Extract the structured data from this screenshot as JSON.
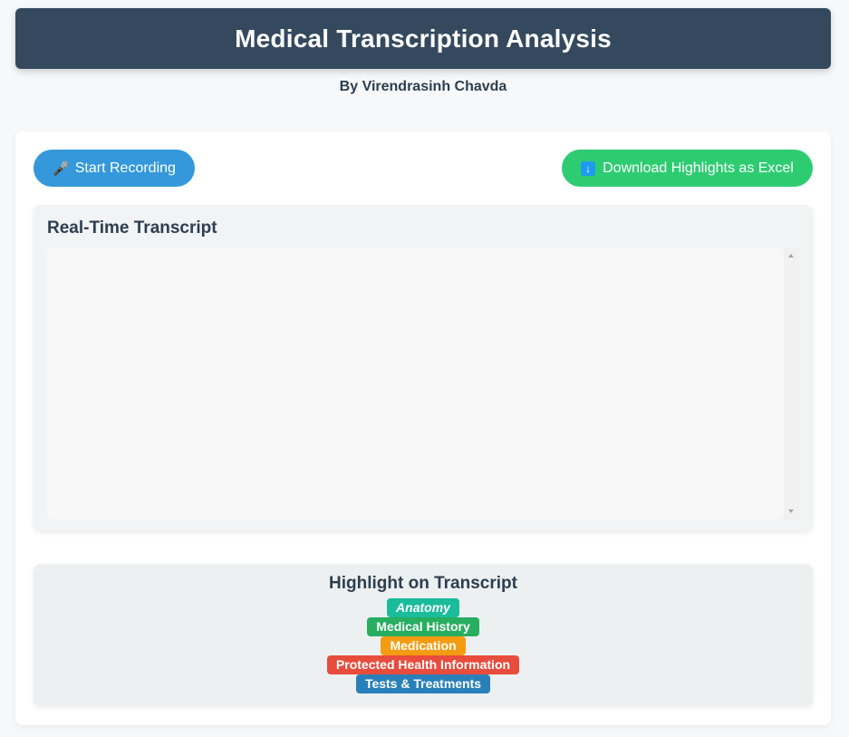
{
  "app": {
    "title": "Medical Transcription Analysis",
    "byline": "By Virendrasinh Chavda"
  },
  "toolbar": {
    "record_icon": "microphone-icon",
    "record_label": "Start Recording",
    "download_icon": "download-arrow-icon",
    "download_label": "Download Highlights as Excel"
  },
  "transcript": {
    "heading": "Real-Time Transcript",
    "text": ""
  },
  "highlights": {
    "heading": "Highlight on Transcript",
    "legend": [
      {
        "label": "Anatomy",
        "color": "#1abc9c",
        "italic": true
      },
      {
        "label": "Medical History",
        "color": "#27ae60",
        "italic": false
      },
      {
        "label": "Medication",
        "color": "#f39c12",
        "italic": false
      },
      {
        "label": "Protected Health Information",
        "color": "#e74c3c",
        "italic": false
      },
      {
        "label": "Tests & Treatments",
        "color": "#2980b9",
        "italic": false
      }
    ]
  },
  "colors": {
    "header_bg": "#34495e",
    "record_button": "#3498db",
    "download_button": "#2ecc71"
  }
}
